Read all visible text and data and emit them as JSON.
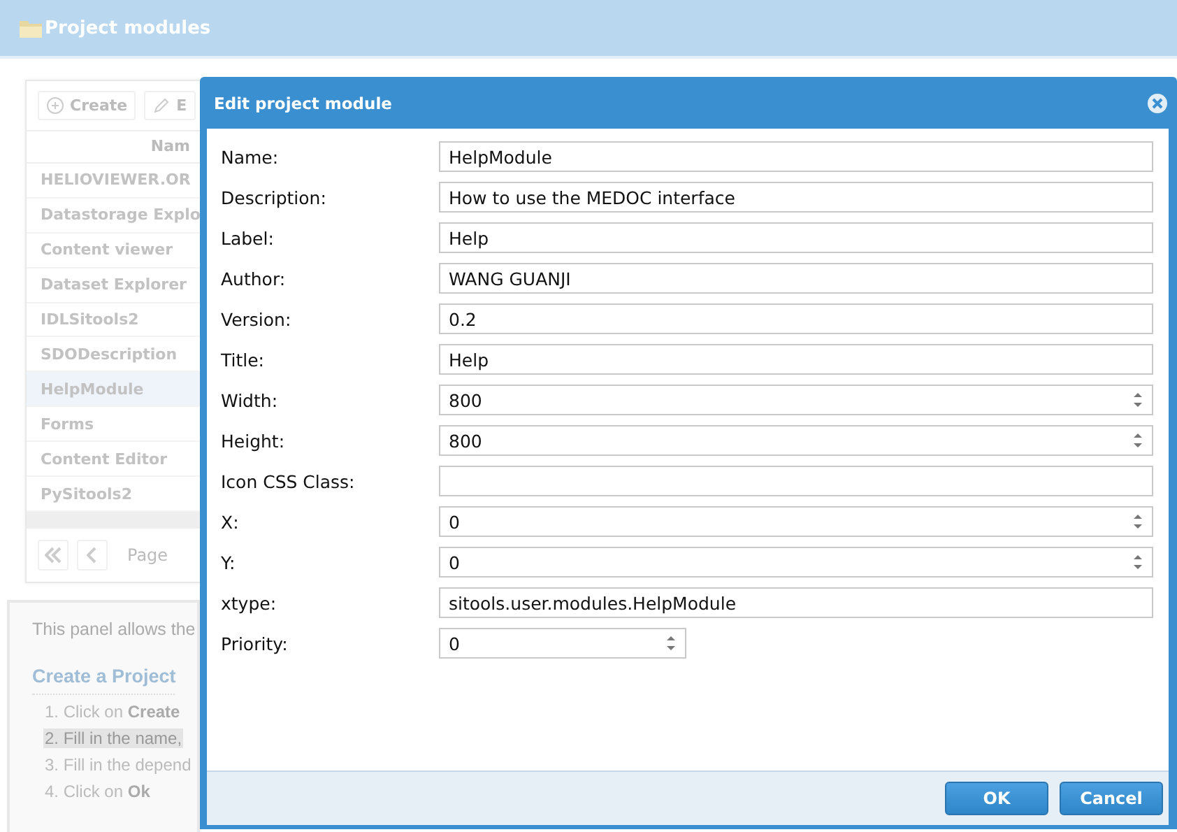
{
  "header": {
    "title": "Project modules"
  },
  "toolbar": {
    "buttons": [
      {
        "label": "Create",
        "kind": "create"
      },
      {
        "label": "E",
        "kind": "edit"
      }
    ]
  },
  "grid": {
    "column_header": "Nam",
    "rows": [
      {
        "name": "HELIOVIEWER.OR",
        "selected": false
      },
      {
        "name": "Datastorage Explo",
        "selected": false
      },
      {
        "name": "Content viewer",
        "selected": false
      },
      {
        "name": "Dataset Explorer",
        "selected": false
      },
      {
        "name": "IDLSitools2",
        "selected": false
      },
      {
        "name": "SDODescription",
        "selected": false
      },
      {
        "name": "HelpModule",
        "selected": true
      },
      {
        "name": "Forms",
        "selected": false
      },
      {
        "name": "Content Editor",
        "selected": false
      },
      {
        "name": "PySitools2",
        "selected": false
      }
    ],
    "pager": {
      "label": "Page"
    }
  },
  "help": {
    "intro": "This panel allows the",
    "heading": "Create a Project",
    "steps": [
      {
        "text": "1. Click on **Create**",
        "highlighted": false
      },
      {
        "text": "2. Fill in the name,",
        "highlighted": true
      },
      {
        "text": "3. Fill in the depend",
        "highlighted": false
      },
      {
        "text": "4. Click on **Ok**",
        "highlighted": false
      }
    ]
  },
  "dialog": {
    "title": "Edit project module",
    "fields": [
      {
        "label": "Name:",
        "value": "HelpModule",
        "kind": "text"
      },
      {
        "label": "Description:",
        "value": "How to use the MEDOC interface",
        "kind": "text"
      },
      {
        "label": "Label:",
        "value": "Help",
        "kind": "text"
      },
      {
        "label": "Author:",
        "value": "WANG GUANJI",
        "kind": "text"
      },
      {
        "label": "Version:",
        "value": "0.2",
        "kind": "text"
      },
      {
        "label": "Title:",
        "value": "Help",
        "kind": "text"
      },
      {
        "label": "Width:",
        "value": "800",
        "kind": "spinner"
      },
      {
        "label": "Height:",
        "value": "800",
        "kind": "spinner"
      },
      {
        "label": "Icon CSS Class:",
        "kind": "text"
      },
      {
        "label": "X:",
        "value": "0",
        "kind": "spinner"
      },
      {
        "label": "Y:",
        "value": "0",
        "kind": "spinner"
      },
      {
        "label": "xtype:",
        "value": "sitools.user.modules.HelpModule",
        "kind": "text"
      },
      {
        "label": "Priority:",
        "value": "0",
        "kind": "short_spinner"
      }
    ],
    "buttons": [
      "OK",
      "Cancel"
    ]
  }
}
